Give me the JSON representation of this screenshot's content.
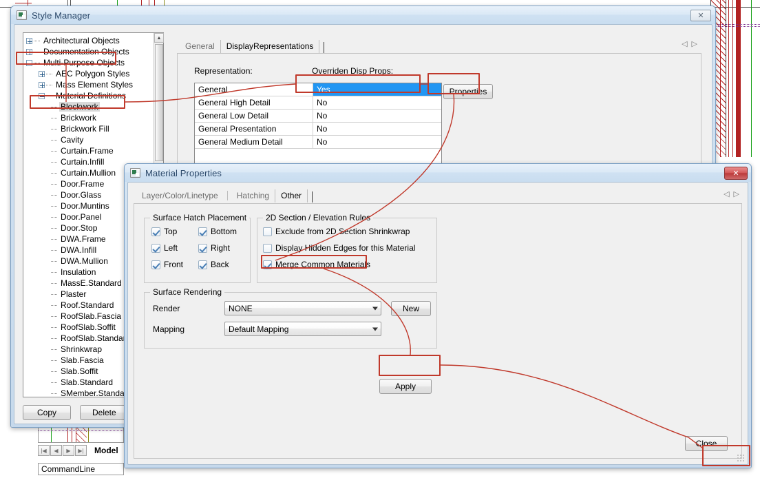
{
  "background": {
    "model_tab_label": "Model",
    "command_line_label": "CommandLine",
    "nav_first": "|◀",
    "nav_prev": "◀",
    "nav_next": "▶",
    "nav_last": "▶|"
  },
  "style_manager": {
    "title": "Style Manager",
    "close_glyph": "✕",
    "tree": [
      {
        "label": "Architectural Objects",
        "indent": 0,
        "toggle": "plus"
      },
      {
        "label": "Documentation Objects",
        "indent": 0,
        "toggle": "plus"
      },
      {
        "label": "Multi-Purpose Objects",
        "indent": 0,
        "toggle": "minus"
      },
      {
        "label": "AEC Polygon Styles",
        "indent": 1,
        "toggle": "plus"
      },
      {
        "label": "Mass Element Styles",
        "indent": 1,
        "toggle": "plus"
      },
      {
        "label": "Material Definitions",
        "indent": 1,
        "toggle": "minus"
      },
      {
        "label": "Blockwork",
        "indent": 2,
        "toggle": "leaf",
        "selected": true
      },
      {
        "label": "Brickwork",
        "indent": 2,
        "toggle": "leaf"
      },
      {
        "label": "Brickwork Fill",
        "indent": 2,
        "toggle": "leaf"
      },
      {
        "label": "Cavity",
        "indent": 2,
        "toggle": "leaf"
      },
      {
        "label": "Curtain.Frame",
        "indent": 2,
        "toggle": "leaf"
      },
      {
        "label": "Curtain.Infill",
        "indent": 2,
        "toggle": "leaf"
      },
      {
        "label": "Curtain.Mullion",
        "indent": 2,
        "toggle": "leaf"
      },
      {
        "label": "Door.Frame",
        "indent": 2,
        "toggle": "leaf"
      },
      {
        "label": "Door.Glass",
        "indent": 2,
        "toggle": "leaf"
      },
      {
        "label": "Door.Muntins",
        "indent": 2,
        "toggle": "leaf"
      },
      {
        "label": "Door.Panel",
        "indent": 2,
        "toggle": "leaf"
      },
      {
        "label": "Door.Stop",
        "indent": 2,
        "toggle": "leaf"
      },
      {
        "label": "DWA.Frame",
        "indent": 2,
        "toggle": "leaf"
      },
      {
        "label": "DWA.Infill",
        "indent": 2,
        "toggle": "leaf"
      },
      {
        "label": "DWA.Mullion",
        "indent": 2,
        "toggle": "leaf"
      },
      {
        "label": "Insulation",
        "indent": 2,
        "toggle": "leaf"
      },
      {
        "label": "MassE.Standard",
        "indent": 2,
        "toggle": "leaf"
      },
      {
        "label": "Plaster",
        "indent": 2,
        "toggle": "leaf"
      },
      {
        "label": "Roof.Standard",
        "indent": 2,
        "toggle": "leaf"
      },
      {
        "label": "RoofSlab.Fascia",
        "indent": 2,
        "toggle": "leaf"
      },
      {
        "label": "RoofSlab.Soffit",
        "indent": 2,
        "toggle": "leaf"
      },
      {
        "label": "RoofSlab.Standard",
        "indent": 2,
        "toggle": "leaf"
      },
      {
        "label": "Shrinkwrap",
        "indent": 2,
        "toggle": "leaf"
      },
      {
        "label": "Slab.Fascia",
        "indent": 2,
        "toggle": "leaf"
      },
      {
        "label": "Slab.Soffit",
        "indent": 2,
        "toggle": "leaf"
      },
      {
        "label": "Slab.Standard",
        "indent": 2,
        "toggle": "leaf"
      },
      {
        "label": "SMember.Standard",
        "indent": 2,
        "toggle": "leaf"
      }
    ],
    "buttons": {
      "copy": "Copy",
      "delete": "Delete"
    },
    "tabs": [
      {
        "label": "General",
        "active": false
      },
      {
        "label": "DisplayRepresentations",
        "active": true
      }
    ],
    "nav_prev": "◁",
    "nav_next": "▷",
    "headers": {
      "representation": "Representation:",
      "overriden": "Overriden Disp Props:"
    },
    "rows": [
      {
        "representation": "General",
        "overriden": "Yes",
        "selected": true
      },
      {
        "representation": "General High Detail",
        "overriden": "No",
        "selected": false
      },
      {
        "representation": "General Low Detail",
        "overriden": "No",
        "selected": false
      },
      {
        "representation": "General Presentation",
        "overriden": "No",
        "selected": false
      },
      {
        "representation": "General Medium Detail",
        "overriden": "No",
        "selected": false
      }
    ],
    "properties_button": "Properties"
  },
  "material_properties": {
    "title": "Material Properties",
    "close_glyph": "✕",
    "tabs": [
      {
        "label": "Layer/Color/Linetype",
        "active": false
      },
      {
        "label": "Hatching",
        "active": false
      },
      {
        "label": "Other",
        "active": true
      }
    ],
    "nav_prev": "◁",
    "nav_next": "▷",
    "surface_hatch_placement": {
      "title": "Surface Hatch Placement",
      "items": [
        {
          "label": "Top",
          "checked": true
        },
        {
          "label": "Bottom",
          "checked": true
        },
        {
          "label": "Left",
          "checked": true
        },
        {
          "label": "Right",
          "checked": true
        },
        {
          "label": "Front",
          "checked": true
        },
        {
          "label": "Back",
          "checked": true
        }
      ]
    },
    "section_elevation_rules": {
      "title": "2D Section / Elevation Rules",
      "items": [
        {
          "label": "Exclude from 2D Section Shrinkwrap",
          "checked": false
        },
        {
          "label": "Display Hidden Edges for this Material",
          "checked": false
        },
        {
          "label": "Merge Common Materials",
          "checked": true
        }
      ]
    },
    "surface_rendering": {
      "title": "Surface Rendering",
      "render_label": "Render",
      "render_value": "NONE",
      "mapping_label": "Mapping",
      "mapping_value": "Default Mapping",
      "new_button": "New"
    },
    "apply_button": "Apply",
    "close_button": "Close"
  },
  "annotation": {
    "color": "#c0392b"
  }
}
